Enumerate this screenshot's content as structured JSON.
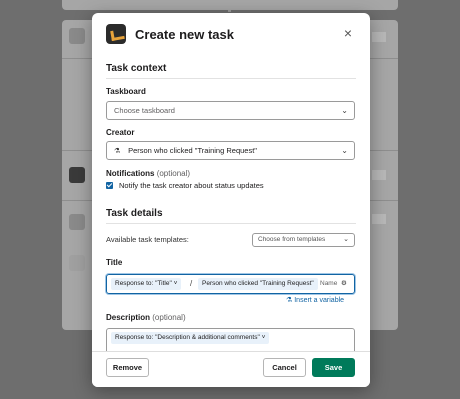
{
  "modal": {
    "title": "Create new task",
    "close_symbol": "×",
    "app_icon": "workflow-app-logo"
  },
  "task_context": {
    "heading": "Task context",
    "taskboard": {
      "label": "Taskboard",
      "placeholder": "Choose taskboard"
    },
    "creator": {
      "label": "Creator",
      "value": "Person who clicked \"Training Request\"",
      "icon": "variable-icon"
    },
    "notifications": {
      "label": "Notifications",
      "optional": "(optional)",
      "checkbox_label": "Notify the task creator about status updates",
      "checked": true
    }
  },
  "task_details": {
    "heading": "Task details",
    "templates_label": "Available task templates:",
    "templates_placeholder": "Choose from templates",
    "title": {
      "label": "Title",
      "token1": "Response to: \"Title\" ˅",
      "separator": "/",
      "token2": "Person who clicked \"Training Request\"",
      "token2_suffix": "Name",
      "insert_variable": "Insert a variable"
    },
    "description": {
      "label": "Description",
      "optional": "(optional)",
      "token": "Response to: \"Description & additional comments\" ˅"
    }
  },
  "footer": {
    "remove_label": "Remove",
    "cancel_label": "Cancel",
    "save_label": "Save"
  },
  "colors": {
    "primary": "#007a5a",
    "link": "#1264a3"
  }
}
